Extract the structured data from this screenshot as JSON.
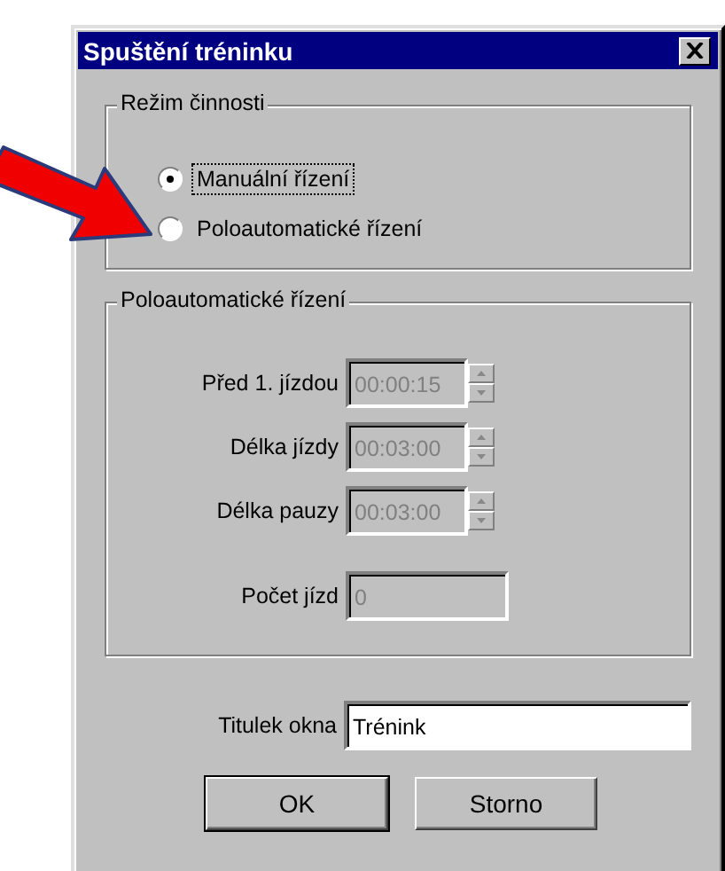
{
  "window": {
    "title": "Spuštění tréninku"
  },
  "mode_group": {
    "label": "Režim činnosti",
    "options": [
      {
        "label": "Manuální řízení",
        "selected": true,
        "focused": true
      },
      {
        "label": "Poloautomatické řízení",
        "selected": false,
        "focused": false
      }
    ]
  },
  "semi_auto_group": {
    "label": "Poloautomatické řízení",
    "fields": [
      {
        "kind": "spinner",
        "label": "Před 1. jízdou",
        "value": "00:00:15",
        "disabled": true
      },
      {
        "kind": "spinner",
        "label": "Délka jízdy",
        "value": "00:03:00",
        "disabled": true
      },
      {
        "kind": "spinner",
        "label": "Délka pauzy",
        "value": "00:03:00",
        "disabled": true
      },
      {
        "kind": "text",
        "label": "Počet jízd",
        "value": "0",
        "disabled": true
      }
    ]
  },
  "title_field": {
    "label": "Titulek okna",
    "value": "Trénink"
  },
  "buttons": [
    {
      "label": "OK",
      "default": true
    },
    {
      "label": "Storno",
      "default": false
    }
  ]
}
